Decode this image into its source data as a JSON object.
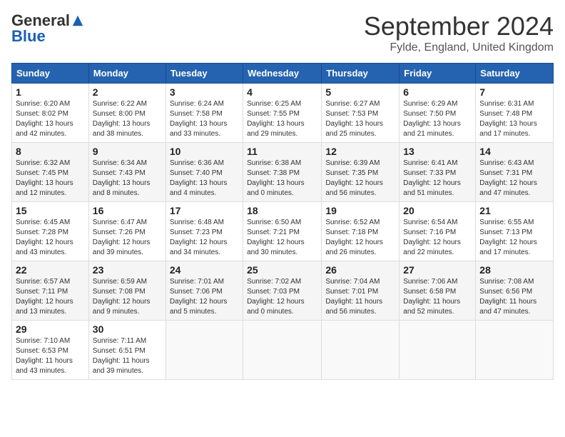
{
  "header": {
    "logo_general": "General",
    "logo_blue": "Blue",
    "month_title": "September 2024",
    "location": "Fylde, England, United Kingdom"
  },
  "calendar": {
    "days_of_week": [
      "Sunday",
      "Monday",
      "Tuesday",
      "Wednesday",
      "Thursday",
      "Friday",
      "Saturday"
    ],
    "weeks": [
      [
        {
          "day": "1",
          "info": "Sunrise: 6:20 AM\nSunset: 8:02 PM\nDaylight: 13 hours\nand 42 minutes."
        },
        {
          "day": "2",
          "info": "Sunrise: 6:22 AM\nSunset: 8:00 PM\nDaylight: 13 hours\nand 38 minutes."
        },
        {
          "day": "3",
          "info": "Sunrise: 6:24 AM\nSunset: 7:58 PM\nDaylight: 13 hours\nand 33 minutes."
        },
        {
          "day": "4",
          "info": "Sunrise: 6:25 AM\nSunset: 7:55 PM\nDaylight: 13 hours\nand 29 minutes."
        },
        {
          "day": "5",
          "info": "Sunrise: 6:27 AM\nSunset: 7:53 PM\nDaylight: 13 hours\nand 25 minutes."
        },
        {
          "day": "6",
          "info": "Sunrise: 6:29 AM\nSunset: 7:50 PM\nDaylight: 13 hours\nand 21 minutes."
        },
        {
          "day": "7",
          "info": "Sunrise: 6:31 AM\nSunset: 7:48 PM\nDaylight: 13 hours\nand 17 minutes."
        }
      ],
      [
        {
          "day": "8",
          "info": "Sunrise: 6:32 AM\nSunset: 7:45 PM\nDaylight: 13 hours\nand 12 minutes."
        },
        {
          "day": "9",
          "info": "Sunrise: 6:34 AM\nSunset: 7:43 PM\nDaylight: 13 hours\nand 8 minutes."
        },
        {
          "day": "10",
          "info": "Sunrise: 6:36 AM\nSunset: 7:40 PM\nDaylight: 13 hours\nand 4 minutes."
        },
        {
          "day": "11",
          "info": "Sunrise: 6:38 AM\nSunset: 7:38 PM\nDaylight: 13 hours\nand 0 minutes."
        },
        {
          "day": "12",
          "info": "Sunrise: 6:39 AM\nSunset: 7:35 PM\nDaylight: 12 hours\nand 56 minutes."
        },
        {
          "day": "13",
          "info": "Sunrise: 6:41 AM\nSunset: 7:33 PM\nDaylight: 12 hours\nand 51 minutes."
        },
        {
          "day": "14",
          "info": "Sunrise: 6:43 AM\nSunset: 7:31 PM\nDaylight: 12 hours\nand 47 minutes."
        }
      ],
      [
        {
          "day": "15",
          "info": "Sunrise: 6:45 AM\nSunset: 7:28 PM\nDaylight: 12 hours\nand 43 minutes."
        },
        {
          "day": "16",
          "info": "Sunrise: 6:47 AM\nSunset: 7:26 PM\nDaylight: 12 hours\nand 39 minutes."
        },
        {
          "day": "17",
          "info": "Sunrise: 6:48 AM\nSunset: 7:23 PM\nDaylight: 12 hours\nand 34 minutes."
        },
        {
          "day": "18",
          "info": "Sunrise: 6:50 AM\nSunset: 7:21 PM\nDaylight: 12 hours\nand 30 minutes."
        },
        {
          "day": "19",
          "info": "Sunrise: 6:52 AM\nSunset: 7:18 PM\nDaylight: 12 hours\nand 26 minutes."
        },
        {
          "day": "20",
          "info": "Sunrise: 6:54 AM\nSunset: 7:16 PM\nDaylight: 12 hours\nand 22 minutes."
        },
        {
          "day": "21",
          "info": "Sunrise: 6:55 AM\nSunset: 7:13 PM\nDaylight: 12 hours\nand 17 minutes."
        }
      ],
      [
        {
          "day": "22",
          "info": "Sunrise: 6:57 AM\nSunset: 7:11 PM\nDaylight: 12 hours\nand 13 minutes."
        },
        {
          "day": "23",
          "info": "Sunrise: 6:59 AM\nSunset: 7:08 PM\nDaylight: 12 hours\nand 9 minutes."
        },
        {
          "day": "24",
          "info": "Sunrise: 7:01 AM\nSunset: 7:06 PM\nDaylight: 12 hours\nand 5 minutes."
        },
        {
          "day": "25",
          "info": "Sunrise: 7:02 AM\nSunset: 7:03 PM\nDaylight: 12 hours\nand 0 minutes."
        },
        {
          "day": "26",
          "info": "Sunrise: 7:04 AM\nSunset: 7:01 PM\nDaylight: 11 hours\nand 56 minutes."
        },
        {
          "day": "27",
          "info": "Sunrise: 7:06 AM\nSunset: 6:58 PM\nDaylight: 11 hours\nand 52 minutes."
        },
        {
          "day": "28",
          "info": "Sunrise: 7:08 AM\nSunset: 6:56 PM\nDaylight: 11 hours\nand 47 minutes."
        }
      ],
      [
        {
          "day": "29",
          "info": "Sunrise: 7:10 AM\nSunset: 6:53 PM\nDaylight: 11 hours\nand 43 minutes."
        },
        {
          "day": "30",
          "info": "Sunrise: 7:11 AM\nSunset: 6:51 PM\nDaylight: 11 hours\nand 39 minutes."
        },
        {
          "day": "",
          "info": ""
        },
        {
          "day": "",
          "info": ""
        },
        {
          "day": "",
          "info": ""
        },
        {
          "day": "",
          "info": ""
        },
        {
          "day": "",
          "info": ""
        }
      ]
    ]
  }
}
